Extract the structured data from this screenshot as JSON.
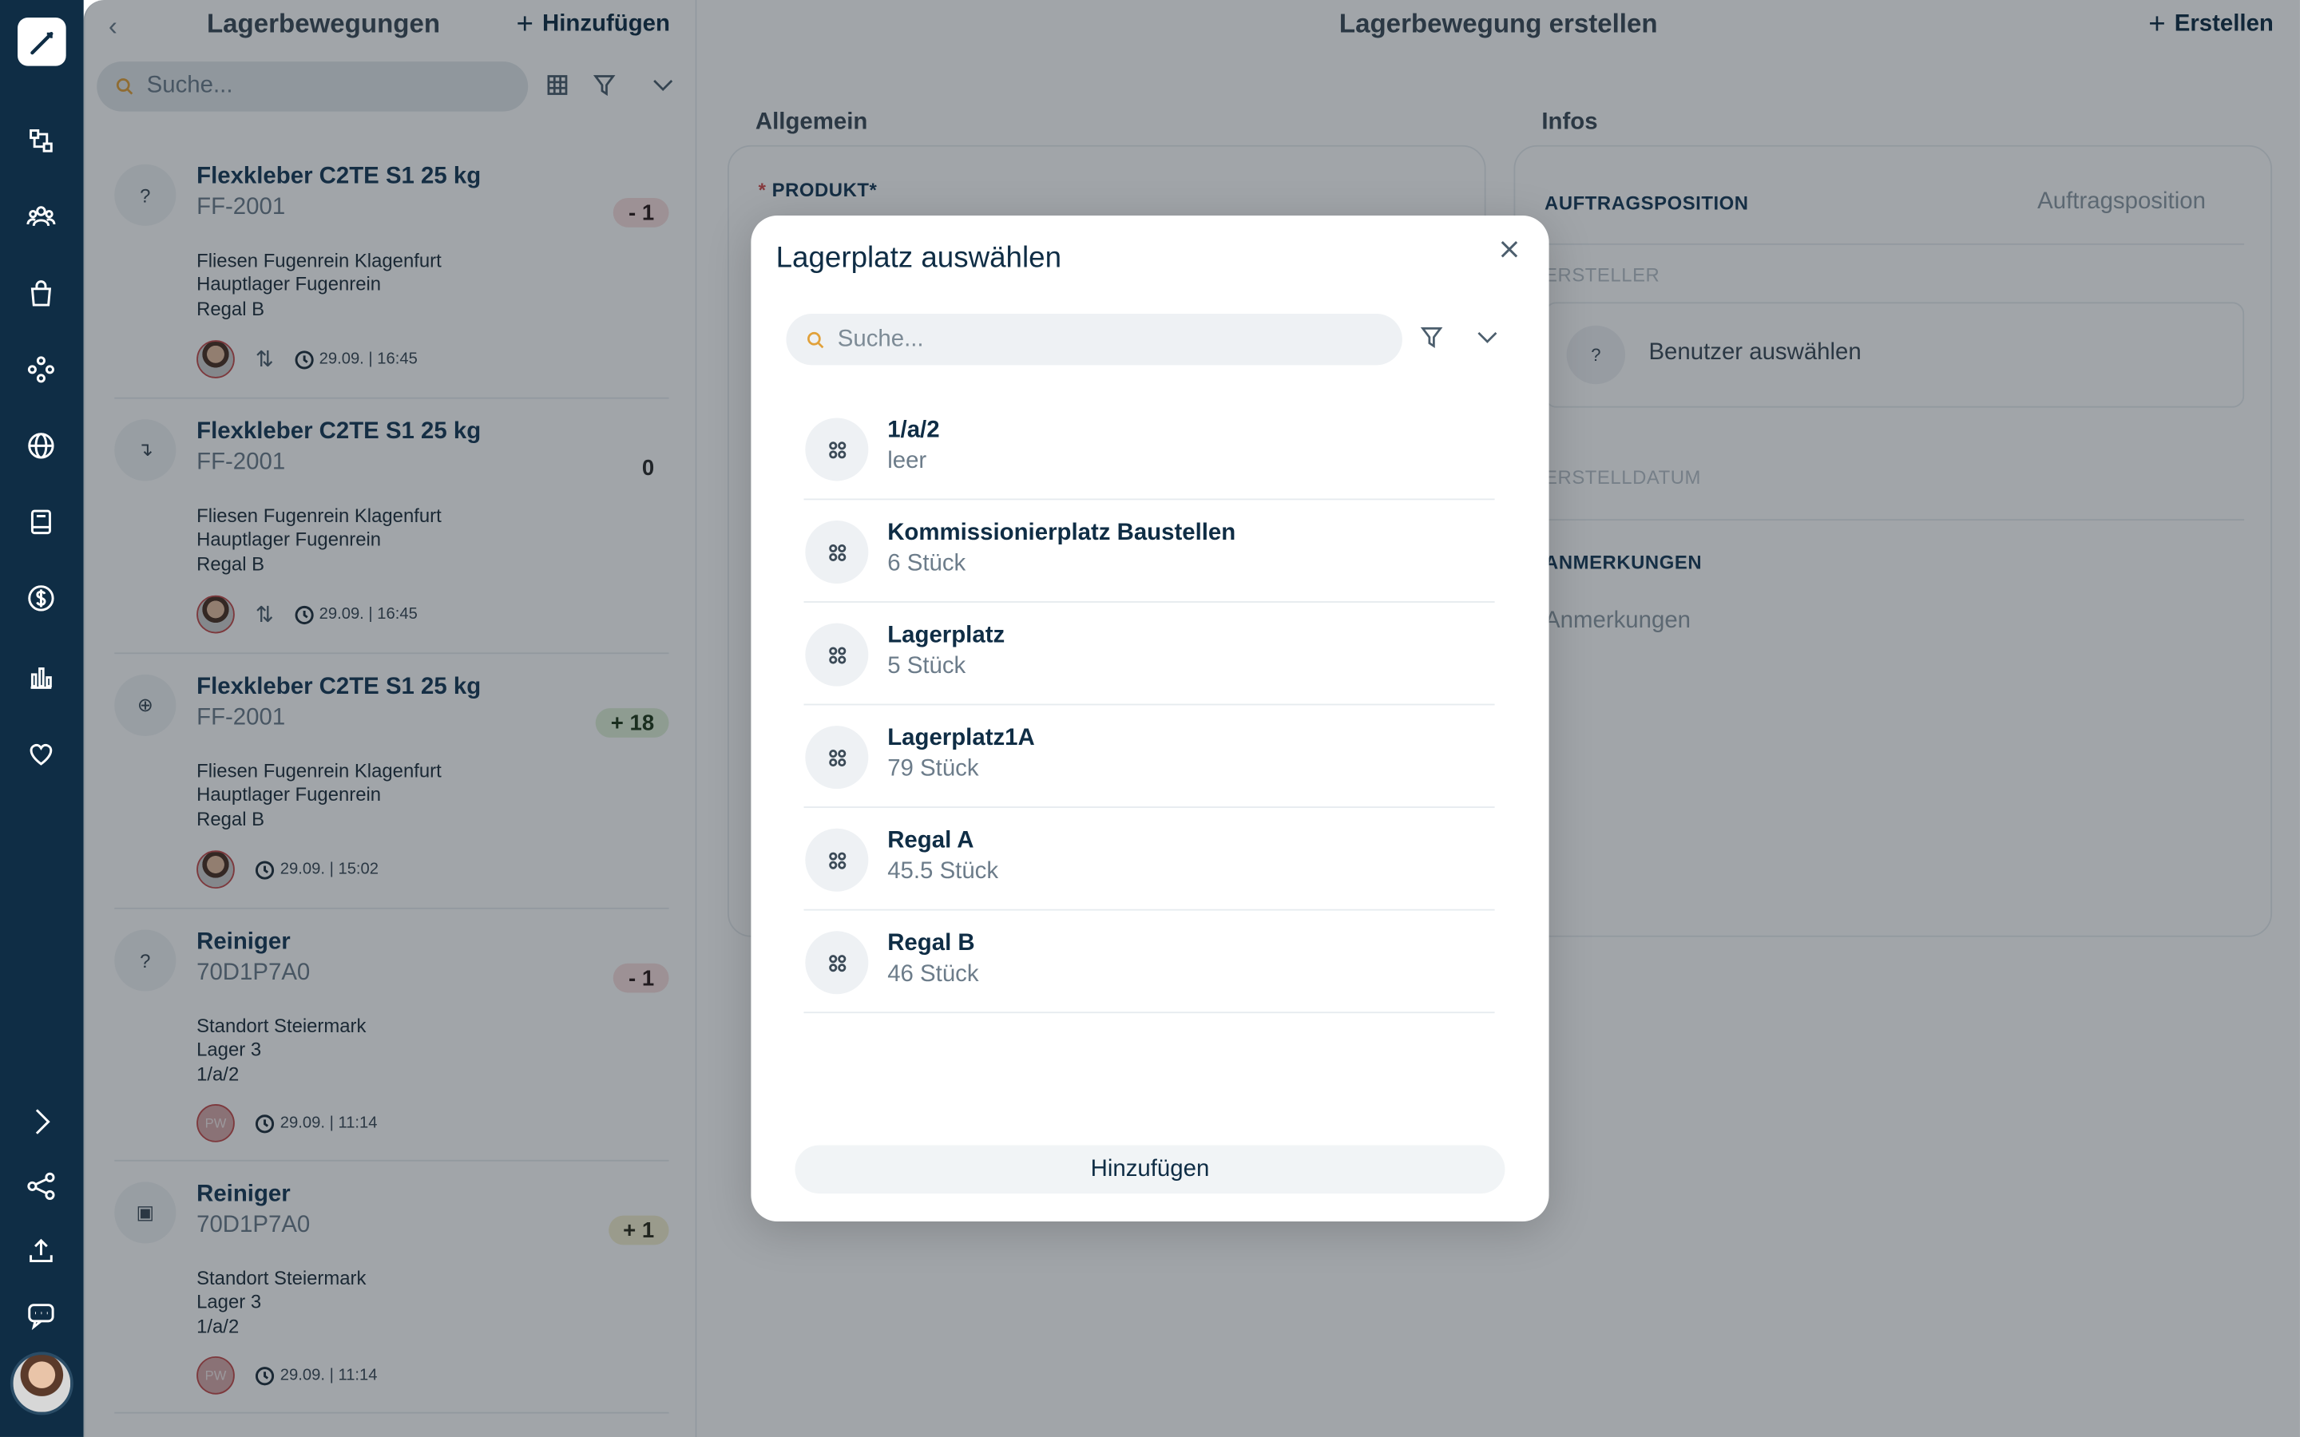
{
  "list": {
    "title": "Lagerbewegungen",
    "add_label": "Hinzufügen",
    "search_placeholder": "Suche...",
    "items": [
      {
        "name": "Flexkleber C2TE S1 25 kg",
        "sku": "FF-2001",
        "loc1": "Fliesen Fugenrein Klagenfurt",
        "loc2": "Hauptlager Fugenrein",
        "loc3": "Regal B",
        "badge": "- 1",
        "time": "29.09. | 16:45",
        "icon": "question-icon"
      },
      {
        "name": "Flexkleber C2TE S1 25 kg",
        "sku": "FF-2001",
        "loc1": "Fliesen Fugenrein Klagenfurt",
        "loc2": "Hauptlager Fugenrein",
        "loc3": "Regal B",
        "badge": "0",
        "time": "29.09. | 16:45",
        "icon": "transfer-icon"
      },
      {
        "name": "Flexkleber C2TE S1 25 kg",
        "sku": "FF-2001",
        "loc1": "Fliesen Fugenrein Klagenfurt",
        "loc2": "Hauptlager Fugenrein",
        "loc3": "Regal B",
        "badge": "+ 18",
        "time": "29.09. | 15:02",
        "icon": "plus-circle-icon"
      },
      {
        "name": "Reiniger",
        "sku": "70D1P7A0",
        "loc1": "Standort Steiermark",
        "loc2": "Lager 3",
        "loc3": "1/a/2",
        "badge": "- 1",
        "time": "29.09. | 11:14",
        "icon": "question-icon",
        "avatar": "PW"
      },
      {
        "name": "Reiniger",
        "sku": "70D1P7A0",
        "loc1": "Standort Steiermark",
        "loc2": "Lager 3",
        "loc3": "1/a/2",
        "badge": "+ 1",
        "time": "29.09. | 11:14",
        "icon": "document-icon",
        "avatar": "PW"
      }
    ]
  },
  "form": {
    "title": "Lagerbewegung erstellen",
    "create_label": "Erstellen",
    "general_title": "Allgemein",
    "product_label": "PRODUKT",
    "req_mark": "*",
    "info_title": "Infos",
    "order_pos_label": "AUFTRAGSPOSITION",
    "order_pos_value": "Auftragsposition",
    "creator_label": "ERSTELLER",
    "user_select": "Benutzer auswählen",
    "created_label": "ERSTELLDATUM",
    "notes_label": "ANMERKUNGEN",
    "notes_placeholder": "Anmerkungen"
  },
  "modal": {
    "title": "Lagerplatz auswählen",
    "search_placeholder": "Suche...",
    "button_label": "Hinzufügen",
    "locations": [
      {
        "name": "1/a/2",
        "qty": "leer"
      },
      {
        "name": "Kommissionierplatz Baustellen",
        "qty": "6 Stück"
      },
      {
        "name": "Lagerplatz",
        "qty": "5 Stück"
      },
      {
        "name": "Lagerplatz1A",
        "qty": "79 Stück"
      },
      {
        "name": "Regal A",
        "qty": "45.5 Stück"
      },
      {
        "name": "Regal B",
        "qty": "46 Stück"
      }
    ]
  },
  "colors": {
    "sidebar": "#0f2d45",
    "accent": "#0f2d45",
    "required": "#d24b4b"
  }
}
